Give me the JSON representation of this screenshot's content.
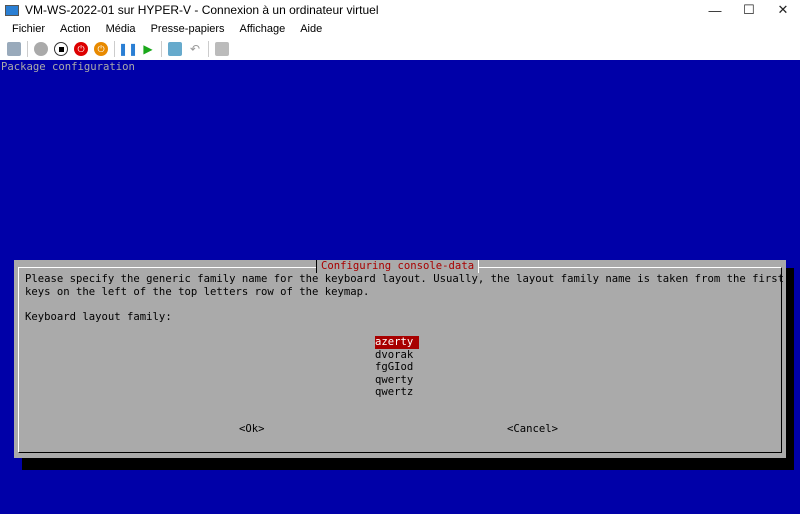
{
  "window": {
    "title": "VM-WS-2022-01 sur HYPER-V - Connexion à un ordinateur virtuel",
    "minimize": "—",
    "maximize": "☐",
    "close": "✕"
  },
  "menu": [
    "Fichier",
    "Action",
    "Média",
    "Presse-papiers",
    "Affichage",
    "Aide"
  ],
  "toolbar": [
    "ctrl-alt-del-icon",
    "start-icon",
    "turn-off-icon",
    "shutdown-icon",
    "save-icon",
    "pause-icon",
    "resume-icon",
    "checkpoint-icon",
    "revert-icon",
    "enhanced-session-icon"
  ],
  "console": {
    "header": "Package configuration",
    "dialog": {
      "title": "Configuring console-data",
      "line1": "Please specify the generic family name for the keyboard layout. Usually, the layout family name is taken from the first",
      "line2": "keys on the left of the top letters row of the keymap.",
      "prompt": "Keyboard layout family:",
      "options": [
        "azerty",
        "dvorak",
        "fgGIod",
        "qwerty",
        "qwertz"
      ],
      "selected": "azerty",
      "ok": "<Ok>",
      "cancel": "<Cancel>"
    }
  }
}
